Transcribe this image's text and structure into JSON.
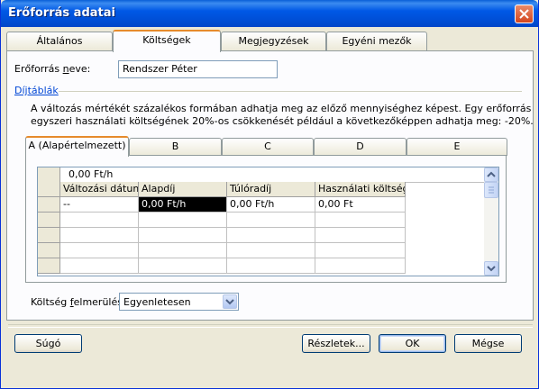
{
  "window": {
    "title": "Erőforrás adatai"
  },
  "tabs": [
    {
      "label": "Általános"
    },
    {
      "label": "Költségek"
    },
    {
      "label": "Megjegyzések"
    },
    {
      "label": "Egyéni mezők"
    }
  ],
  "resource_name": {
    "label_prefix": "Erőforrás ",
    "label_underlined": "n",
    "label_suffix": "eve:",
    "value": "Rendszer Péter"
  },
  "rates": {
    "group_label": "Díjtáblák",
    "description_line1": "A változás mértékét százalékos formában adhatja meg az előző mennyiséghez képest. Egy erőforrás",
    "description_line2": "egyszeri használati költségének 20%-os csökkenését például a következőképpen adhatja meg: -20%."
  },
  "rate_tabs": [
    {
      "label": "A (Alapértelmezett)"
    },
    {
      "label": "B"
    },
    {
      "label": "C"
    },
    {
      "label": "D"
    },
    {
      "label": "E"
    }
  ],
  "table": {
    "edit_value": "0,00 Ft/h",
    "columns": [
      "Változási dátum",
      "Alapdíj",
      "Túlóradíj",
      "Használati költség"
    ],
    "rows": [
      [
        "--",
        "0,00 Ft/h",
        "0,00 Ft/h",
        "0,00 Ft"
      ]
    ]
  },
  "cost_accrual": {
    "label_prefix": "Költség ",
    "label_underlined": "f",
    "label_suffix": "elmerülése:",
    "value": "Egyenletesen"
  },
  "buttons": {
    "help": "Súgó",
    "details": "Részletek...",
    "ok": "OK",
    "cancel": "Mégse"
  }
}
